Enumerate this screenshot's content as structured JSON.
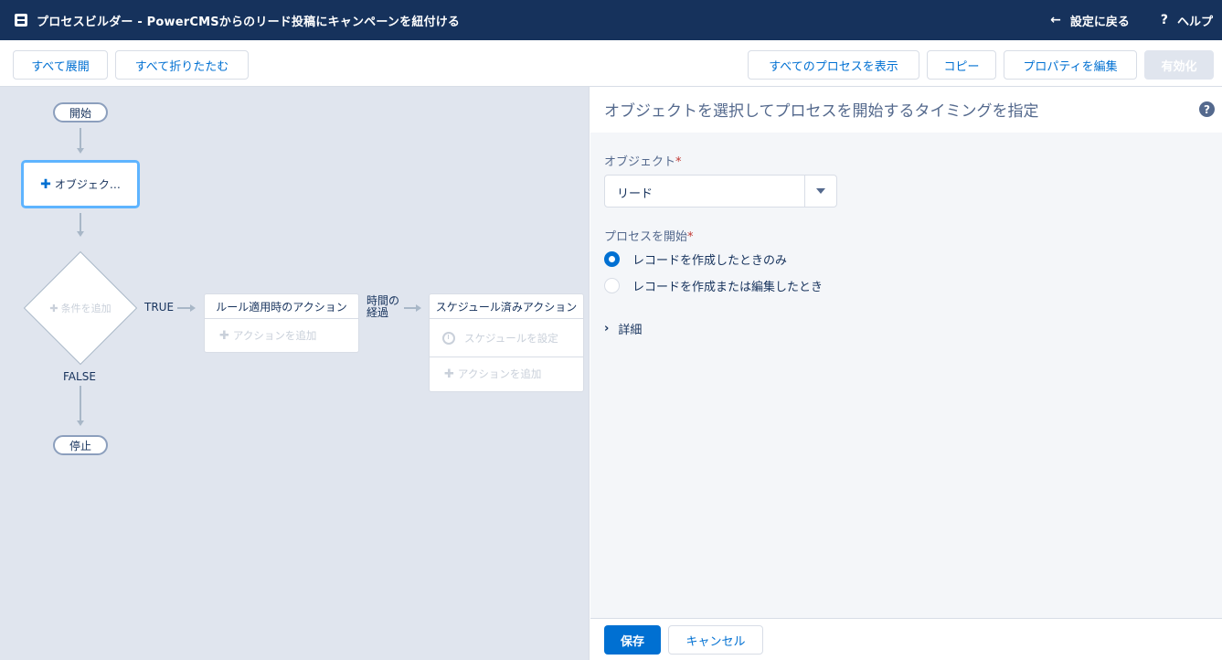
{
  "header": {
    "title": "プロセスビルダー - PowerCMSからのリード投稿にキャンペーンを紐付ける",
    "back_label": "設定に戻る",
    "help_label": "ヘルプ"
  },
  "toolbar": {
    "expand_all": "すべて展開",
    "collapse_all": "すべて折りたたむ",
    "view_all_processes": "すべてのプロセスを表示",
    "copy": "コピー",
    "edit_properties": "プロパティを編集",
    "activate": "有効化"
  },
  "canvas": {
    "start": "開始",
    "object_node": "オブジェク…",
    "add_criteria": "条件を追加",
    "true_label": "TRUE",
    "false_label": "FALSE",
    "stop": "停止",
    "immediate_actions": {
      "title": "ルール適用時のアクション",
      "add_action": "アクションを追加"
    },
    "time_elapsed": [
      "時間の",
      "経過"
    ],
    "scheduled_actions": {
      "title": "スケジュール済みアクション",
      "set_schedule": "スケジュールを設定",
      "add_action": "アクションを追加"
    }
  },
  "panel": {
    "title": "オブジェクトを選択してプロセスを開始するタイミングを指定",
    "object_label": "オブジェクト",
    "object_value": "リード",
    "start_label": "プロセスを開始",
    "options": [
      {
        "label": "レコードを作成したときのみ",
        "selected": true
      },
      {
        "label": "レコードを作成または編集したとき",
        "selected": false
      }
    ],
    "details_label": "詳細",
    "save": "保存",
    "cancel": "キャンセル"
  },
  "colors": {
    "header_bg": "#16325c",
    "accent": "#0070d2",
    "canvas_bg": "#e0e5ee",
    "selected_border": "#5eb4ff"
  }
}
